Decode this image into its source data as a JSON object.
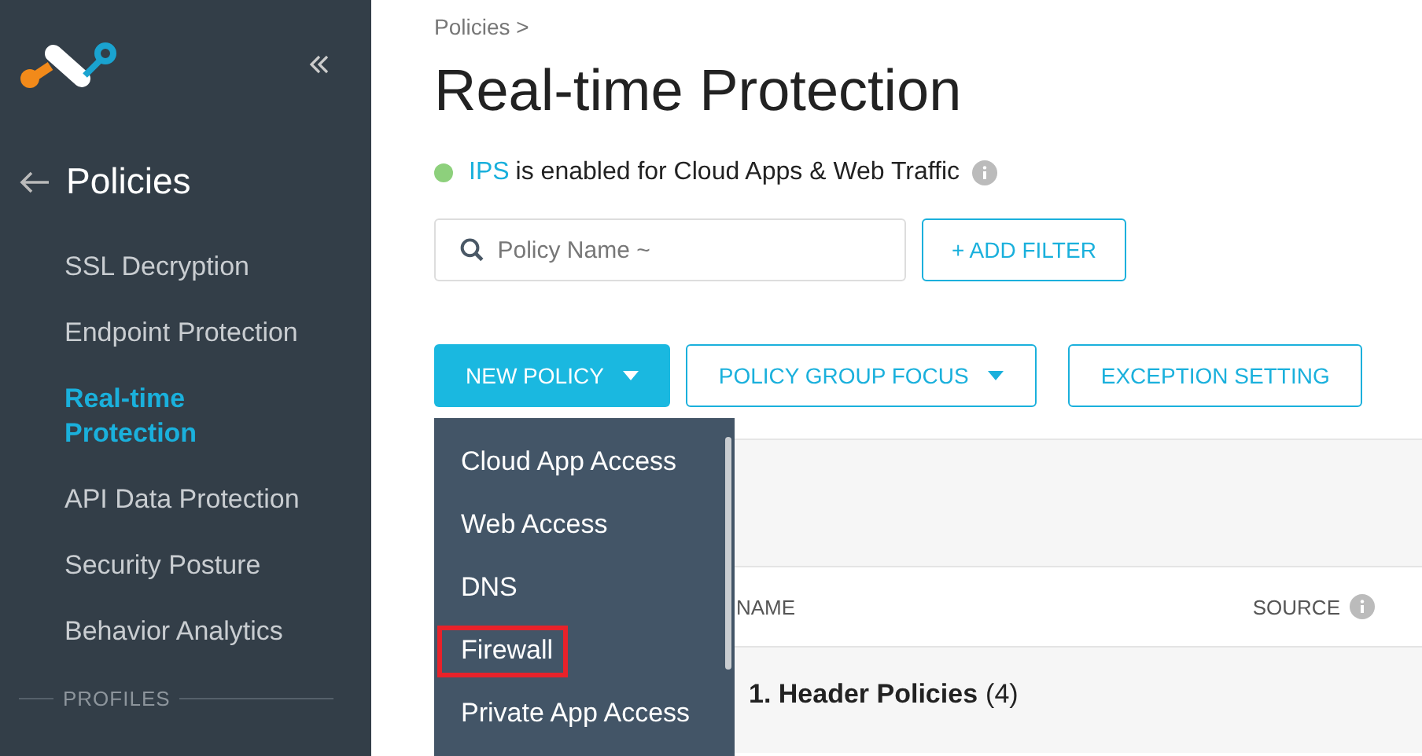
{
  "sidebar": {
    "back_title": "Policies",
    "items": [
      {
        "label": "SSL Decryption",
        "selected": false
      },
      {
        "label": "Endpoint Protection",
        "selected": false
      },
      {
        "label": "Real-time Protection",
        "selected": true
      },
      {
        "label": "API Data Protection",
        "selected": false
      },
      {
        "label": "Security Posture",
        "selected": false
      },
      {
        "label": "Behavior Analytics",
        "selected": false
      }
    ],
    "section_heading": "PROFILES"
  },
  "breadcrumb": "Policies >",
  "title": "Real-time Protection",
  "status": {
    "enabled": true,
    "feature": "IPS",
    "text": "is enabled for Cloud Apps & Web Traffic"
  },
  "search": {
    "placeholder": "Policy Name ~"
  },
  "add_filter": "+ ADD FILTER",
  "buttons": [
    {
      "label": "NEW POLICY",
      "kind": "primary",
      "dropdown": true
    },
    {
      "label": "POLICY GROUP FOCUS",
      "kind": "outline",
      "dropdown": true
    },
    {
      "label": "EXCEPTION SETTING",
      "kind": "outline",
      "dropdown": false
    }
  ],
  "menu": [
    {
      "label": "Cloud App Access",
      "highlighted": false
    },
    {
      "label": "Web Access",
      "highlighted": false
    },
    {
      "label": "DNS",
      "highlighted": false
    },
    {
      "label": "Firewall",
      "highlighted": true
    },
    {
      "label": "Private App Access",
      "highlighted": false
    }
  ],
  "table": {
    "columns": [
      "NAME",
      "SOURCE"
    ],
    "group": {
      "label": "1. Header Policies",
      "count": "(4)"
    }
  }
}
